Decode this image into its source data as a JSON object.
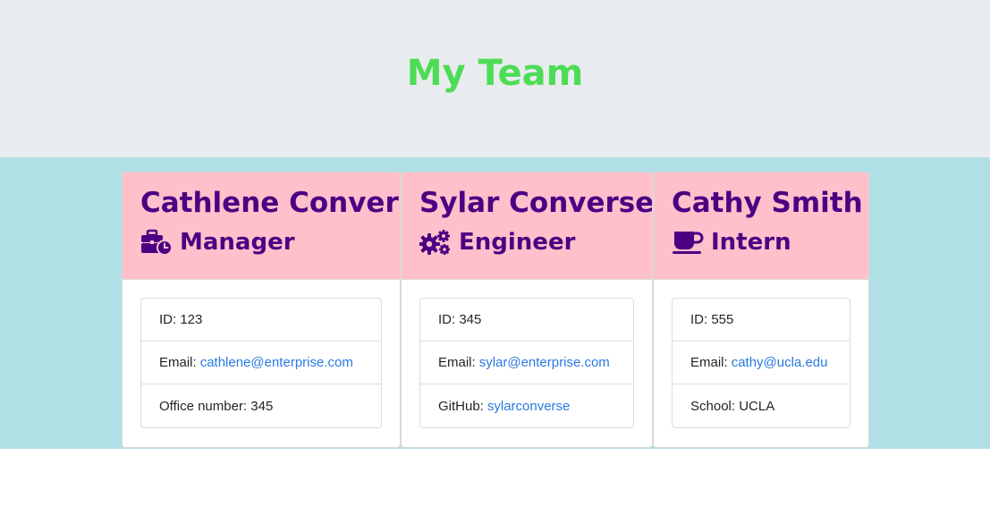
{
  "header": {
    "title": "My Team"
  },
  "colors": {
    "title": "#4ddc55",
    "header_bg": "#e9ecef",
    "team_bg": "#b0e0e6",
    "card_header_bg": "#ffc0cb",
    "card_header_text": "#4b0082",
    "link": "#2a7ae2"
  },
  "employees": [
    {
      "name": "Cathlene Converse",
      "role": "Manager",
      "icon": "briefcase-clock-icon",
      "id_label": "ID: 123",
      "email_label": "Email:",
      "email": "cathlene@enterprise.com",
      "extra_label": "Office number: 345"
    },
    {
      "name": "Sylar Converse",
      "role": "Engineer",
      "icon": "gears-icon",
      "id_label": "ID: 345",
      "email_label": "Email:",
      "email": "sylar@enterprise.com",
      "extra_label": "GitHub:",
      "extra_link": "sylarconverse"
    },
    {
      "name": "Cathy Smith",
      "role": "Intern",
      "icon": "coffee-cup-icon",
      "id_label": "ID: 555",
      "email_label": "Email:",
      "email": "cathy@ucla.edu",
      "extra_label": "School: UCLA"
    }
  ]
}
